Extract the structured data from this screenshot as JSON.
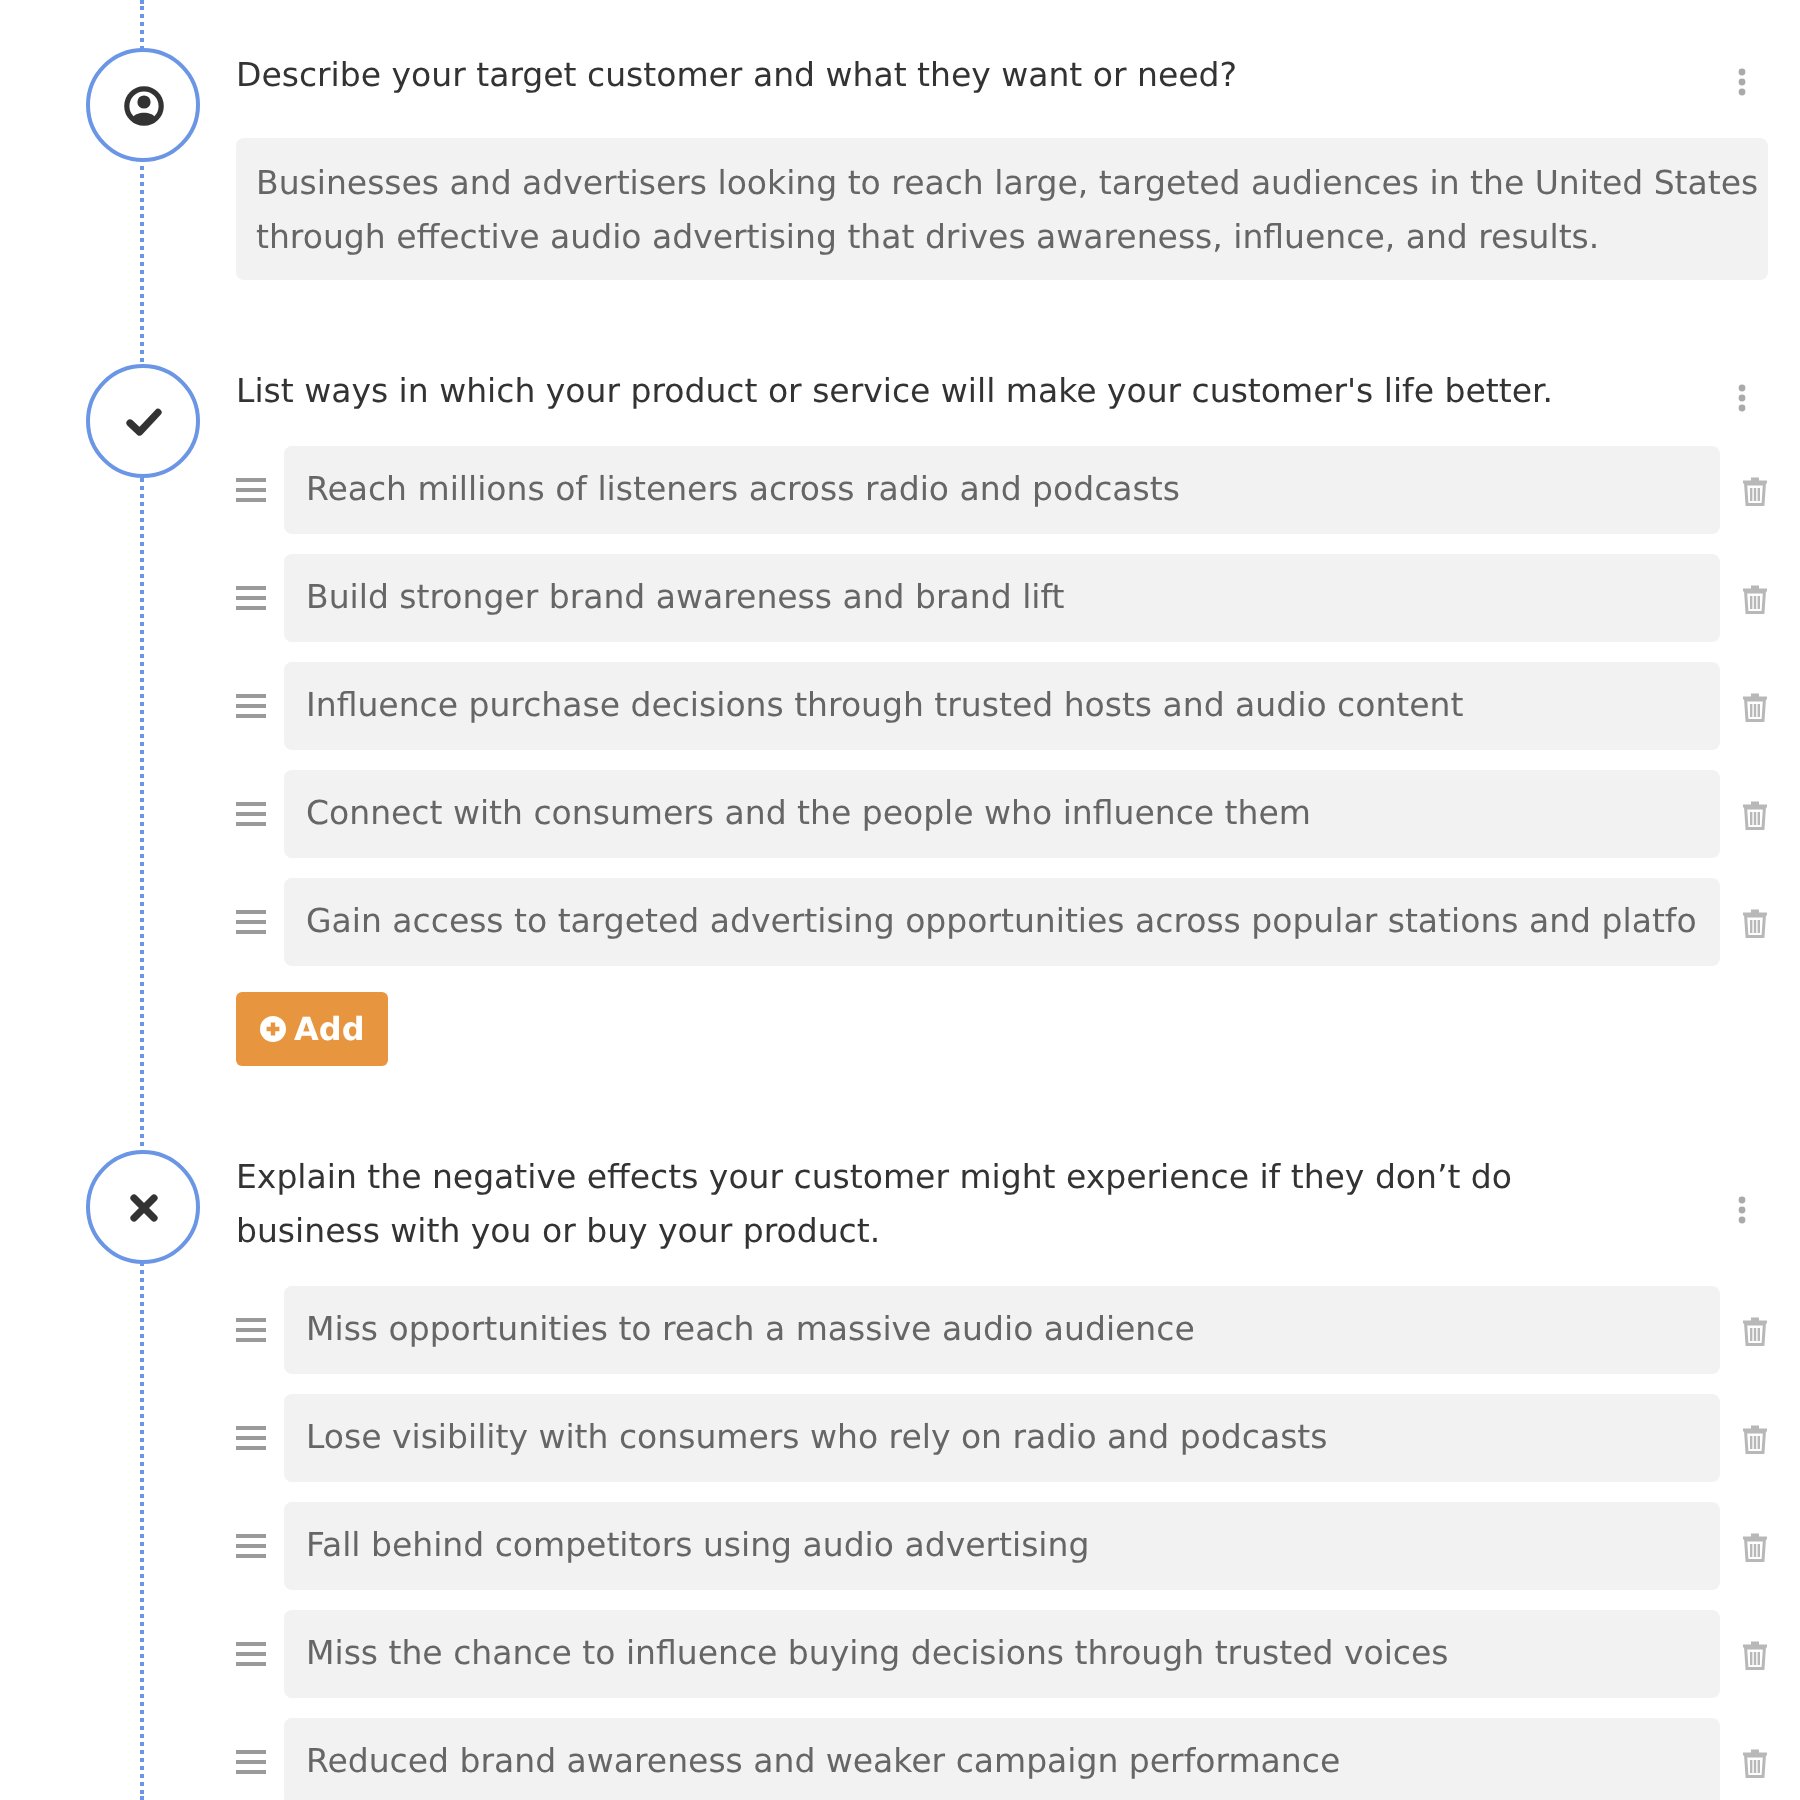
{
  "sections": [
    {
      "kind": "text",
      "question": "Describe your target customer and what they want or need?",
      "answer": "Businesses and advertisers looking to reach large, targeted audiences in the United States through effective audio advertising that drives awareness, influence, and results."
    },
    {
      "kind": "list",
      "question": "List ways in which your product or service will make your customer's life better.",
      "items": [
        "Reach millions of listeners across radio and podcasts",
        "Build stronger brand awareness and brand lift",
        "Influence purchase decisions through trusted hosts and audio content",
        "Connect with consumers and the people who influence them",
        "Gain access to targeted advertising opportunities across popular stations and platfo"
      ],
      "add_button": "Add"
    },
    {
      "kind": "list",
      "question": "Explain the negative effects your customer might experience if they don’t do business with you or buy your product.",
      "items": [
        "Miss opportunities to reach a massive audio audience",
        "Lose visibility with consumers who rely on radio and podcasts",
        "Fall behind competitors using audio advertising",
        "Miss the chance to influence buying decisions through trusted voices",
        "Reduced brand awareness and weaker campaign performance"
      ]
    }
  ]
}
